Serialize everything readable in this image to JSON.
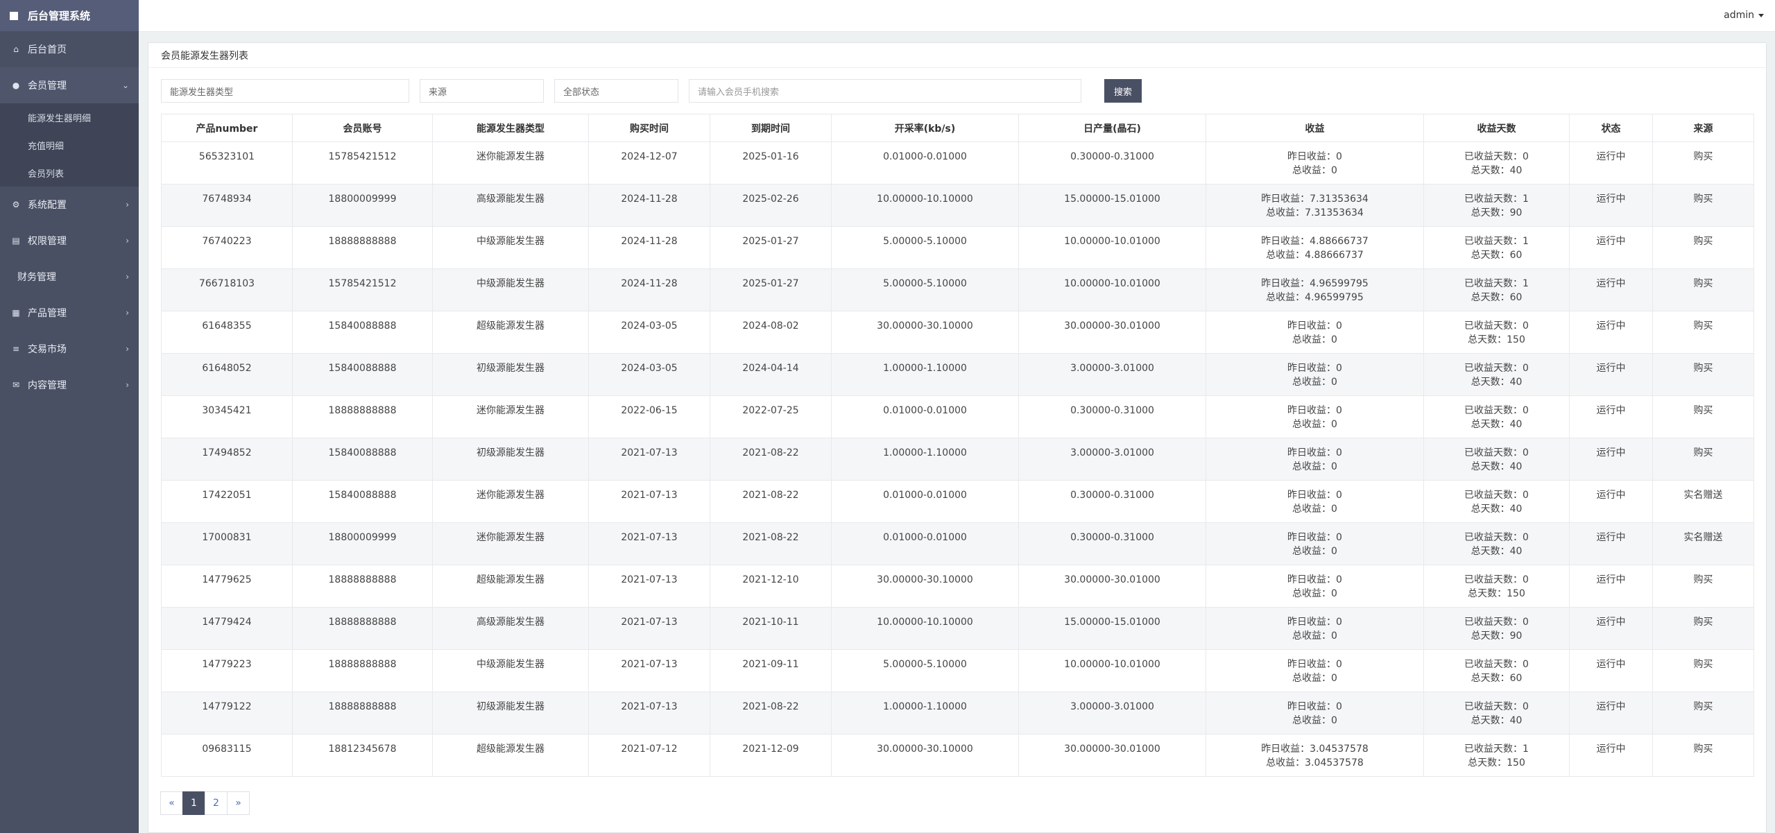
{
  "app": {
    "title": "后台管理系统"
  },
  "sidebar": {
    "items": [
      {
        "label": "后台首页"
      },
      {
        "label": "会员管理"
      },
      {
        "label": "系统配置"
      },
      {
        "label": "权限管理"
      },
      {
        "label": "财务管理"
      },
      {
        "label": "产品管理"
      },
      {
        "label": "交易市场"
      },
      {
        "label": "内容管理"
      }
    ],
    "member_sub": [
      {
        "label": "能源发生器明细"
      },
      {
        "label": "充值明细"
      },
      {
        "label": "会员列表"
      }
    ]
  },
  "topbar": {
    "user": "admin"
  },
  "panel": {
    "title": "会员能源发生器列表"
  },
  "filters": {
    "type_placeholder": "能源发生器类型",
    "source_placeholder": "来源",
    "status_placeholder": "全部状态",
    "phone_placeholder": "请输入会员手机搜索",
    "search_label": "搜索"
  },
  "table": {
    "headers": [
      "产品number",
      "会员账号",
      "能源发生器类型",
      "购买时间",
      "到期时间",
      "开采率(kb/s)",
      "日产量(晶石)",
      "收益",
      "收益天数",
      "状态",
      "来源"
    ],
    "rows": [
      [
        "565323101",
        "15785421512",
        "迷你能源发生器",
        "2024-12-07",
        "2025-01-16",
        "0.01000-0.01000",
        "0.30000-0.31000",
        "昨日收益：0",
        "总收益：0",
        "已收益天数：0",
        "总天数：40",
        "运行中",
        "购买"
      ],
      [
        "76748934",
        "18800009999",
        "高级源能发生器",
        "2024-11-28",
        "2025-02-26",
        "10.00000-10.10000",
        "15.00000-15.01000",
        "昨日收益：7.31353634",
        "总收益：7.31353634",
        "已收益天数：1",
        "总天数：90",
        "运行中",
        "购买"
      ],
      [
        "76740223",
        "18888888888",
        "中级源能发生器",
        "2024-11-28",
        "2025-01-27",
        "5.00000-5.10000",
        "10.00000-10.01000",
        "昨日收益：4.88666737",
        "总收益：4.88666737",
        "已收益天数：1",
        "总天数：60",
        "运行中",
        "购买"
      ],
      [
        "766718103",
        "15785421512",
        "中级源能发生器",
        "2024-11-28",
        "2025-01-27",
        "5.00000-5.10000",
        "10.00000-10.01000",
        "昨日收益：4.96599795",
        "总收益：4.96599795",
        "已收益天数：1",
        "总天数：60",
        "运行中",
        "购买"
      ],
      [
        "61648355",
        "15840088888",
        "超级能源发生器",
        "2024-03-05",
        "2024-08-02",
        "30.00000-30.10000",
        "30.00000-30.01000",
        "昨日收益：0",
        "总收益：0",
        "已收益天数：0",
        "总天数：150",
        "运行中",
        "购买"
      ],
      [
        "61648052",
        "15840088888",
        "初级源能发生器",
        "2024-03-05",
        "2024-04-14",
        "1.00000-1.10000",
        "3.00000-3.01000",
        "昨日收益：0",
        "总收益：0",
        "已收益天数：0",
        "总天数：40",
        "运行中",
        "购买"
      ],
      [
        "30345421",
        "18888888888",
        "迷你能源发生器",
        "2022-06-15",
        "2022-07-25",
        "0.01000-0.01000",
        "0.30000-0.31000",
        "昨日收益：0",
        "总收益：0",
        "已收益天数：0",
        "总天数：40",
        "运行中",
        "购买"
      ],
      [
        "17494852",
        "15840088888",
        "初级源能发生器",
        "2021-07-13",
        "2021-08-22",
        "1.00000-1.10000",
        "3.00000-3.01000",
        "昨日收益：0",
        "总收益：0",
        "已收益天数：0",
        "总天数：40",
        "运行中",
        "购买"
      ],
      [
        "17422051",
        "15840088888",
        "迷你能源发生器",
        "2021-07-13",
        "2021-08-22",
        "0.01000-0.01000",
        "0.30000-0.31000",
        "昨日收益：0",
        "总收益：0",
        "已收益天数：0",
        "总天数：40",
        "运行中",
        "实名赠送"
      ],
      [
        "17000831",
        "18800009999",
        "迷你能源发生器",
        "2021-07-13",
        "2021-08-22",
        "0.01000-0.01000",
        "0.30000-0.31000",
        "昨日收益：0",
        "总收益：0",
        "已收益天数：0",
        "总天数：40",
        "运行中",
        "实名赠送"
      ],
      [
        "14779625",
        "18888888888",
        "超级能源发生器",
        "2021-07-13",
        "2021-12-10",
        "30.00000-30.10000",
        "30.00000-30.01000",
        "昨日收益：0",
        "总收益：0",
        "已收益天数：0",
        "总天数：150",
        "运行中",
        "购买"
      ],
      [
        "14779424",
        "18888888888",
        "高级源能发生器",
        "2021-07-13",
        "2021-10-11",
        "10.00000-10.10000",
        "15.00000-15.01000",
        "昨日收益：0",
        "总收益：0",
        "已收益天数：0",
        "总天数：90",
        "运行中",
        "购买"
      ],
      [
        "14779223",
        "18888888888",
        "中级源能发生器",
        "2021-07-13",
        "2021-09-11",
        "5.00000-5.10000",
        "10.00000-10.01000",
        "昨日收益：0",
        "总收益：0",
        "已收益天数：0",
        "总天数：60",
        "运行中",
        "购买"
      ],
      [
        "14779122",
        "18888888888",
        "初级源能发生器",
        "2021-07-13",
        "2021-08-22",
        "1.00000-1.10000",
        "3.00000-3.01000",
        "昨日收益：0",
        "总收益：0",
        "已收益天数：0",
        "总天数：40",
        "运行中",
        "购买"
      ],
      [
        "09683115",
        "18812345678",
        "超级能源发生器",
        "2021-07-12",
        "2021-12-09",
        "30.00000-30.10000",
        "30.00000-30.01000",
        "昨日收益：3.04537578",
        "总收益：3.04537578",
        "已收益天数：1",
        "总天数：150",
        "运行中",
        "购买"
      ]
    ]
  },
  "pagination": {
    "prev": "«",
    "pages": [
      "1",
      "2"
    ],
    "next": "»",
    "current": "1"
  }
}
